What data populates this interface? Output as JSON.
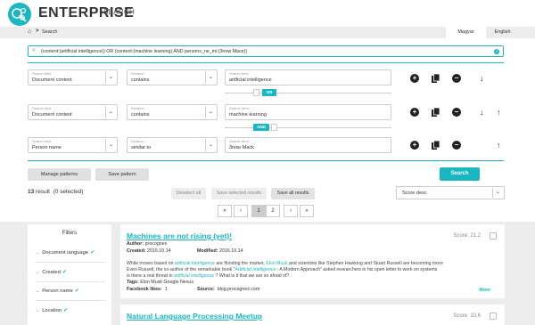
{
  "app": {
    "logo_text": "ENTERPRISE",
    "logo_sub": "SEARCH",
    "brand_color": "#1ab6c2"
  },
  "nav": {
    "breadcrumb_label": "Search",
    "languages": [
      "Magyar",
      "English"
    ]
  },
  "query": {
    "text": "(content:(artificial intelligence)) OR (content:(machine learning) AND persons_ne_mi:(3now Mace))"
  },
  "conditions": [
    {
      "field_label": "Search field",
      "field_value": "Document content",
      "relation_label": "Relation",
      "relation_value": "contains",
      "term_label": "Search term",
      "term_value": "artificial intelligence"
    },
    {
      "field_label": "Search field",
      "field_value": "Document content",
      "relation_label": "Relation",
      "relation_value": "contains",
      "term_label": "Search term",
      "term_value": "machine learning"
    },
    {
      "field_label": "Search field",
      "field_value": "Person name",
      "relation_label": "Relation",
      "relation_value": "similar to",
      "term_label": "Search term",
      "term_value": "3now Mack"
    }
  ],
  "operators": [
    "OR",
    "AND"
  ],
  "buttons": {
    "manage_patterns": "Manage patterns",
    "save_pattern": "Save pattern",
    "search": "Search",
    "deselect_all": "Deselect all",
    "save_selected": "Save selected results",
    "save_all": "Save all results"
  },
  "results_info": {
    "count": "13",
    "count_suffix": " result",
    "selected": "(0 selected)"
  },
  "sort": {
    "selected": "Score desc"
  },
  "pagination": {
    "first": "«",
    "prev": "‹",
    "pages": [
      "1",
      "2"
    ],
    "next": "›",
    "last": "»",
    "current": "1"
  },
  "filters": {
    "title": "Filters",
    "items": [
      "Document language",
      "Created",
      "Person name",
      "Location"
    ]
  },
  "results": [
    {
      "title": "Machines are not rising (yet)!",
      "score": "Score: 21.2",
      "author_label": "Author:",
      "author": "procognex",
      "created_label": "Created:",
      "created": "2016.10.14",
      "modified_label": "Modified:",
      "modified": "2016.10.14",
      "snippet": {
        "l1_a": "While moves based on ",
        "l1_h1": "artificial",
        "l1_b": " ",
        "l1_h2": "intelligence",
        "l1_c": " are flooding the market, ",
        "l1_h3": "Elon",
        "l1_d": " ",
        "l1_h4": "Musk",
        "l1_e": " and scientists like Stephen Hawking and Stuart Russell are becoming more",
        "l2_a": "Even Russell, the co-author of the remarkable book \"",
        "l2_h1": "Artificial",
        "l2_b": " ",
        "l2_h2": "Intelligence",
        "l2_c": " : A Modern Approach\" asked researchers in his open letter to work on systems",
        "l3_a": "is there a real threat in ",
        "l3_h1": "artificial",
        "l3_b": " ",
        "l3_h2": "intelligence",
        "l3_c": " ? What is it that we are so afraid of?"
      },
      "tags_label": "Tags:",
      "tags": "Elon Musk  Google  Nexus",
      "likes_label": "Facebook likes:",
      "likes": "1",
      "source_label": "Source:",
      "source": "blog.procognex.com",
      "more": "More"
    },
    {
      "title": "Natural Language Processing Meetup",
      "score": "Score: 10.6"
    }
  ]
}
